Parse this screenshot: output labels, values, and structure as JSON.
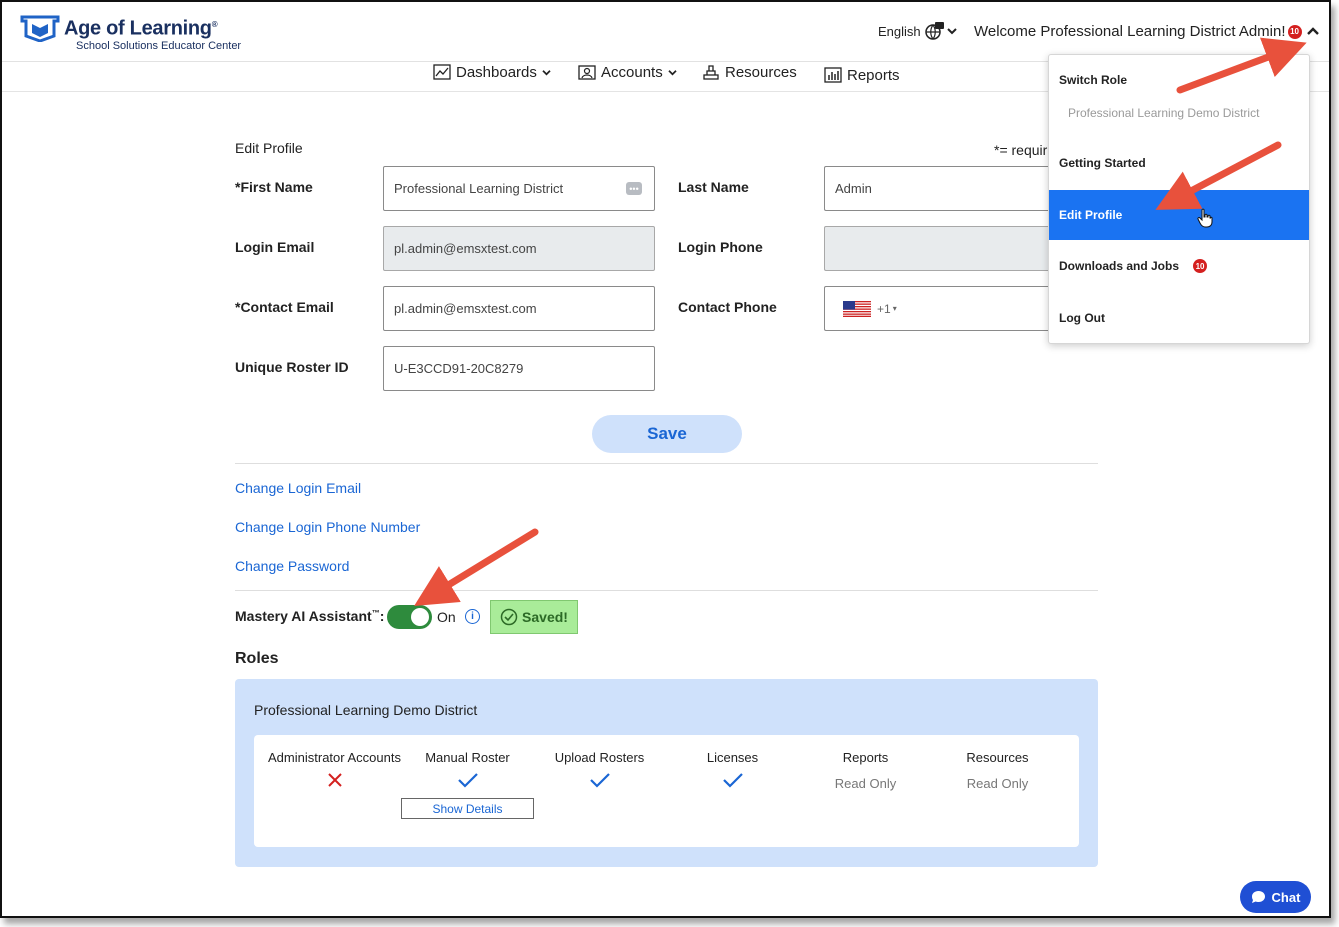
{
  "header": {
    "logo_title": "Age of Learning",
    "logo_sub": "School Solutions Educator Center",
    "language": "English",
    "welcome": "Welcome Professional Learning District Admin!",
    "notification_count": "10"
  },
  "nav": {
    "dashboards": "Dashboards",
    "accounts": "Accounts",
    "resources": "Resources",
    "reports": "Reports"
  },
  "form": {
    "title": "Edit Profile",
    "required_note": "*= requir",
    "first_name_label": "*First Name",
    "first_name_value": "Professional Learning District",
    "last_name_label": "Last Name",
    "last_name_value": "Admin",
    "login_email_label": "Login Email",
    "login_email_value": "pl.admin@emsxtest.com",
    "login_phone_label": "Login Phone",
    "contact_email_label": "*Contact Email",
    "contact_email_value": "pl.admin@emsxtest.com",
    "contact_phone_label": "Contact Phone",
    "contact_phone_code": "+1",
    "roster_id_label": "Unique Roster ID",
    "roster_id_value": "U-E3CCD91-20C8279",
    "save_label": "Save"
  },
  "links": {
    "change_email": "Change Login Email",
    "change_phone": "Change Login Phone Number",
    "change_password": "Change Password"
  },
  "mastery": {
    "label": "Mastery AI Assistant",
    "tm": "™",
    "colon": ":",
    "state": "On",
    "saved": "Saved!"
  },
  "roles": {
    "title": "Roles",
    "district": "Professional Learning Demo District",
    "permissions": [
      {
        "name": "Administrator Accounts",
        "value": "x"
      },
      {
        "name": "Manual Roster",
        "value": "check"
      },
      {
        "name": "Upload Rosters",
        "value": "check"
      },
      {
        "name": "Licenses",
        "value": "check"
      },
      {
        "name": "Reports",
        "value": "Read Only"
      },
      {
        "name": "Resources",
        "value": "Read Only"
      }
    ],
    "show_details": "Show Details"
  },
  "dropdown": {
    "switch_role": "Switch Role",
    "district": "Professional Learning Demo District",
    "getting_started": "Getting Started",
    "edit_profile": "Edit Profile",
    "downloads": "Downloads and Jobs",
    "downloads_count": "10",
    "log_out": "Log Out"
  },
  "chat": {
    "label": "Chat"
  },
  "colors": {
    "accent": "#1a66d4",
    "active": "#1a73f2",
    "toggle_on": "#2e8b3d",
    "arrow": "#e8513c"
  }
}
